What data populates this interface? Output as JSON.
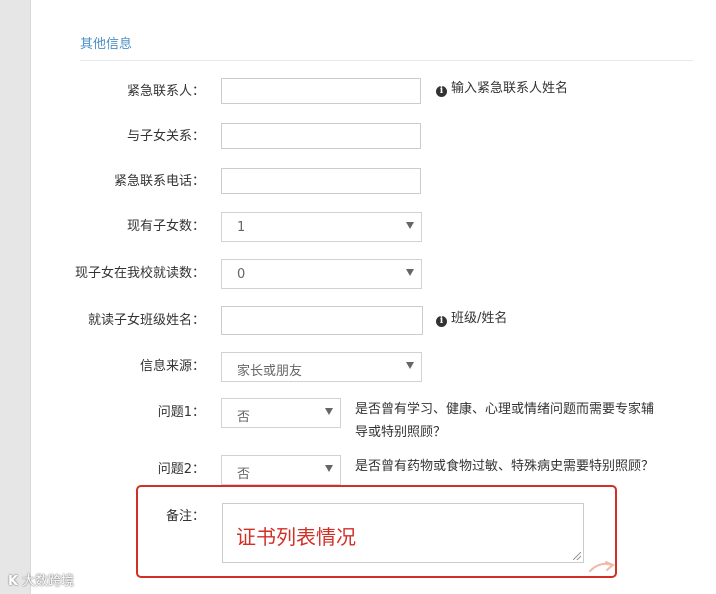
{
  "section": {
    "title": "其他信息"
  },
  "form": {
    "emergency_contact": {
      "label": "紧急联系人：",
      "value": "",
      "hint_icon": "info-icon",
      "hint": "输入紧急联系人姓名"
    },
    "relation": {
      "label": "与子女关系：",
      "value": ""
    },
    "emergency_phone": {
      "label": "紧急联系电话：",
      "value": ""
    },
    "children_count": {
      "label": "现有子女数：",
      "selected": "1"
    },
    "children_in_school": {
      "label": "现子女在我校就读数：",
      "selected": "0"
    },
    "children_class_name": {
      "label": "就读子女班级姓名：",
      "value": "",
      "hint_icon": "info-icon",
      "hint": "班级/姓名"
    },
    "info_source": {
      "label": "信息来源：",
      "selected": "家长或朋友"
    },
    "question1": {
      "label": "问题1：",
      "selected": "否",
      "text": "是否曾有学习、健康、心理或情绪问题而需要专家辅导或特别照顾？"
    },
    "question2": {
      "label": "问题2：",
      "selected": "否",
      "text": "是否曾有药物或食物过敏、特殊病史需要特别照顾？"
    },
    "remarks": {
      "label": "备注：",
      "value": "证书列表情况"
    }
  },
  "watermark": {
    "logo": "K",
    "text": "大数跨境"
  },
  "colors": {
    "section_title": "#4a8fc7",
    "highlight": "#d13027"
  }
}
